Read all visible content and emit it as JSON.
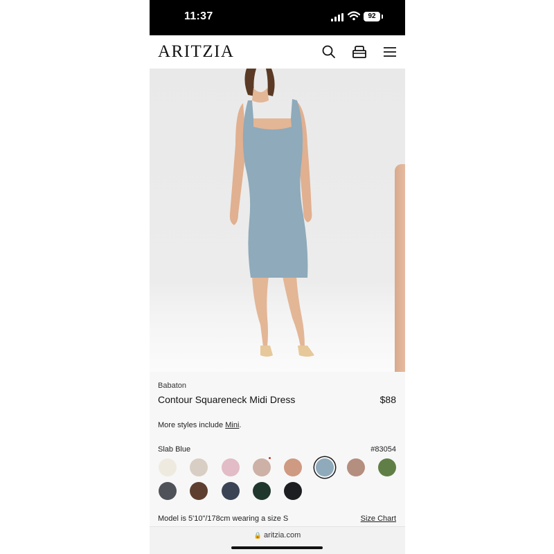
{
  "status_bar": {
    "time": "11:37",
    "battery": "92"
  },
  "header": {
    "logo": "ARITZIA"
  },
  "product": {
    "brand": "Babaton",
    "name": "Contour Squareneck Midi Dress",
    "price": "$88",
    "more_styles_prefix": "More styles include ",
    "more_styles_link": "Mini",
    "more_styles_suffix": ".",
    "selected_color": "Slab Blue",
    "sku": "#83054",
    "model_info": "Model is 5'10\"/178cm wearing a size S",
    "size_chart_label": "Size Chart"
  },
  "swatches": [
    {
      "color": "#efeae0"
    },
    {
      "color": "#d8cec4"
    },
    {
      "color": "#e2bcc6"
    },
    {
      "color": "#cdb1a6"
    },
    {
      "color": "#cf9a82"
    },
    {
      "color": "#8eaabb"
    },
    {
      "color": "#b48e7e"
    },
    {
      "color": "#607f46"
    },
    {
      "color": "#4f5258"
    },
    {
      "color": "#5e3f2f"
    },
    {
      "color": "#3a4454"
    },
    {
      "color": "#20372e"
    },
    {
      "color": "#1d1e21"
    }
  ],
  "selected_swatch_index": 5,
  "browser": {
    "url": "aritzia.com"
  }
}
